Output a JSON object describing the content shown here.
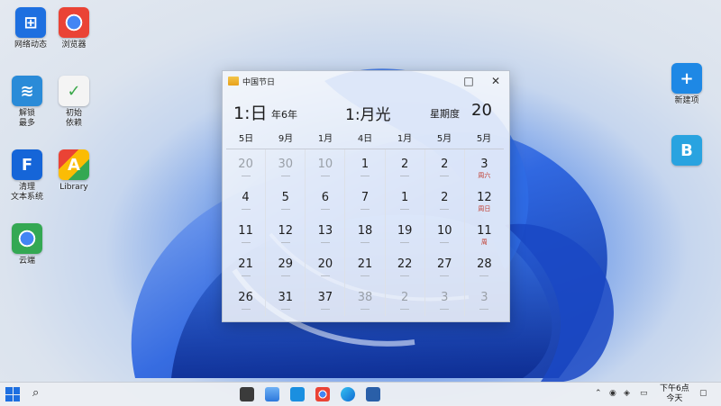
{
  "desktop_icons": [
    {
      "label": "网络动态",
      "icon": "windows-tile-icon",
      "color": "#1d6fe0"
    },
    {
      "label": "浏览器",
      "icon": "chrome-icon",
      "color": "#e94235"
    },
    {
      "label": "解锁\n最多",
      "icon": "stack-icon",
      "color": "#2a8bd8"
    },
    {
      "label": "初始\n依赖",
      "icon": "check-doc-icon",
      "color": "#3aa84a"
    },
    {
      "label": "清理\n文本系统",
      "icon": "f-app-icon",
      "color": "#1565d8"
    },
    {
      "label": "Library",
      "icon": "colorful-app-icon",
      "color": "#f4b400"
    },
    {
      "label": "云端",
      "icon": "chrome-icon-2",
      "color": "#34a853"
    },
    {
      "label": "新建项",
      "icon": "plus-tile-icon",
      "color": "#1e88e5"
    },
    {
      "label": "",
      "icon": "b-tile-icon",
      "color": "#29a3e0"
    }
  ],
  "window": {
    "title": "中国节日",
    "maximize": "□",
    "close": "✕"
  },
  "calendar": {
    "header_day": "1:日",
    "header_year": "年6年",
    "header_mid": "1:月光",
    "header_mode": "星期度",
    "header_num": "20",
    "weekdays": [
      "5日",
      "9月",
      "1月",
      "4日",
      "1月",
      "5月",
      "5月"
    ],
    "rows": [
      [
        {
          "d": "20",
          "dim": true
        },
        {
          "d": "30",
          "dim": true
        },
        {
          "d": "10",
          "dim": true
        },
        {
          "d": "1"
        },
        {
          "d": "2"
        },
        {
          "d": "2"
        },
        {
          "d": "3",
          "sub": "周六"
        }
      ],
      [
        {
          "d": "4"
        },
        {
          "d": "5"
        },
        {
          "d": "6"
        },
        {
          "d": "7"
        },
        {
          "d": "1"
        },
        {
          "d": "2"
        },
        {
          "d": "12",
          "sub": "周日"
        }
      ],
      [
        {
          "d": "11"
        },
        {
          "d": "12"
        },
        {
          "d": "13"
        },
        {
          "d": "18"
        },
        {
          "d": "19"
        },
        {
          "d": "10"
        },
        {
          "d": "11",
          "sub": "周"
        }
      ],
      [
        {
          "d": "21"
        },
        {
          "d": "29"
        },
        {
          "d": "20"
        },
        {
          "d": "21"
        },
        {
          "d": "22"
        },
        {
          "d": "27"
        },
        {
          "d": "28"
        }
      ],
      [
        {
          "d": "26"
        },
        {
          "d": "31"
        },
        {
          "d": "37"
        },
        {
          "d": "38",
          "dim": true
        },
        {
          "d": "2",
          "dim": true
        },
        {
          "d": "3",
          "dim": true
        },
        {
          "d": "3",
          "dim": true
        }
      ]
    ]
  },
  "taskbar": {
    "search_glyph": "⌕",
    "clock_line1": "下午6点",
    "clock_line2": "今天",
    "apps": [
      "start-tiles",
      "photos",
      "mail",
      "chrome",
      "edge",
      "calendar"
    ]
  }
}
